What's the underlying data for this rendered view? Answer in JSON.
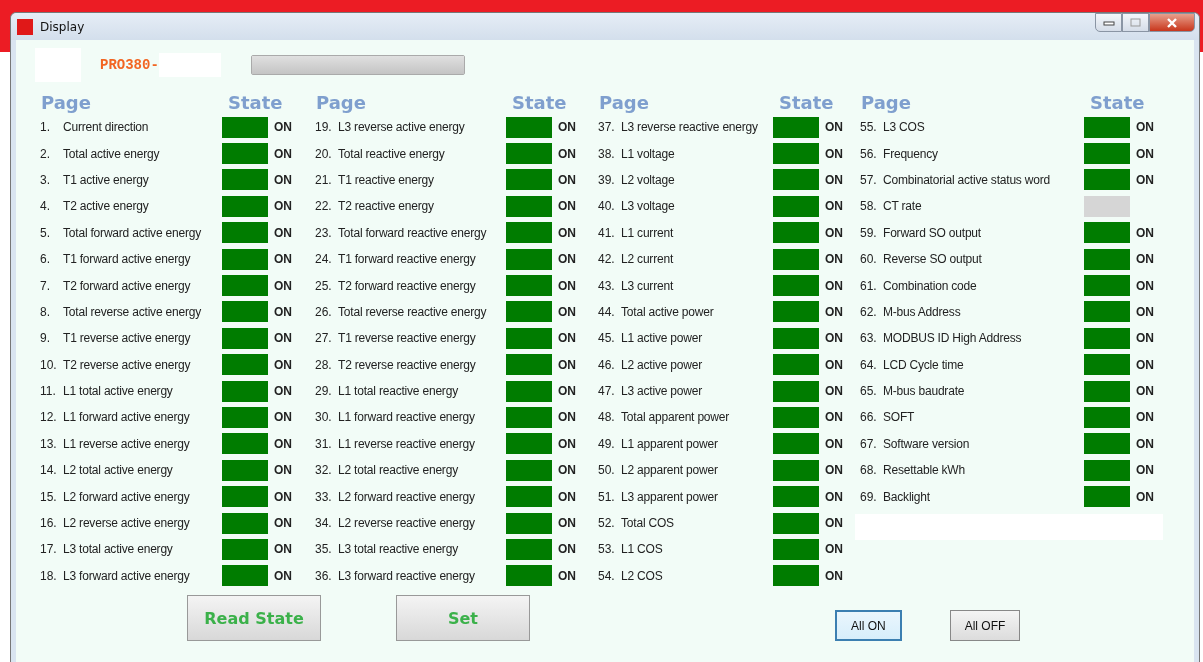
{
  "window": {
    "title": "Display"
  },
  "model": {
    "prefix": "PRO380-"
  },
  "progress": {
    "level": 1
  },
  "columns": [
    {
      "page_header": "Page",
      "state_header": "State",
      "items": [
        {
          "number": "1.",
          "label": "Current direction",
          "on": true,
          "state_text": "ON"
        },
        {
          "number": "2.",
          "label": "Total active energy",
          "on": true,
          "state_text": "ON"
        },
        {
          "number": "3.",
          "label": "T1 active energy",
          "on": true,
          "state_text": "ON"
        },
        {
          "number": "4.",
          "label": "T2 active energy",
          "on": true,
          "state_text": "ON"
        },
        {
          "number": "5.",
          "label": "Total forward active energy",
          "on": true,
          "state_text": "ON"
        },
        {
          "number": "6.",
          "label": "T1 forward active energy",
          "on": true,
          "state_text": "ON"
        },
        {
          "number": "7.",
          "label": "T2 forward active energy",
          "on": true,
          "state_text": "ON"
        },
        {
          "number": "8.",
          "label": "Total reverse active energy",
          "on": true,
          "state_text": "ON"
        },
        {
          "number": "9.",
          "label": "T1 reverse active energy",
          "on": true,
          "state_text": "ON"
        },
        {
          "number": "10.",
          "label": "T2 reverse active energy",
          "on": true,
          "state_text": "ON"
        },
        {
          "number": "11.",
          "label": "L1 total active energy",
          "on": true,
          "state_text": "ON"
        },
        {
          "number": "12.",
          "label": "L1 forward active energy",
          "on": true,
          "state_text": "ON"
        },
        {
          "number": "13.",
          "label": "L1 reverse active energy",
          "on": true,
          "state_text": "ON"
        },
        {
          "number": "14.",
          "label": "L2 total active energy",
          "on": true,
          "state_text": "ON"
        },
        {
          "number": "15.",
          "label": "L2 forward active energy",
          "on": true,
          "state_text": "ON"
        },
        {
          "number": "16.",
          "label": "L2 reverse active energy",
          "on": true,
          "state_text": "ON"
        },
        {
          "number": "17.",
          "label": "L3 total active energy",
          "on": true,
          "state_text": "ON"
        },
        {
          "number": "18.",
          "label": "L3 forward active energy",
          "on": true,
          "state_text": "ON"
        }
      ]
    },
    {
      "page_header": "Page",
      "state_header": "State",
      "items": [
        {
          "number": "19.",
          "label": "L3 reverse active energy",
          "on": true,
          "state_text": "ON"
        },
        {
          "number": "20.",
          "label": "Total reactive energy",
          "on": true,
          "state_text": "ON"
        },
        {
          "number": "21.",
          "label": "T1 reactive energy",
          "on": true,
          "state_text": "ON"
        },
        {
          "number": "22.",
          "label": "T2 reactive energy",
          "on": true,
          "state_text": "ON"
        },
        {
          "number": "23.",
          "label": "Total forward reactive energy",
          "on": true,
          "state_text": "ON"
        },
        {
          "number": "24.",
          "label": "T1 forward reactive energy",
          "on": true,
          "state_text": "ON"
        },
        {
          "number": "25.",
          "label": "T2 forward reactive energy",
          "on": true,
          "state_text": "ON"
        },
        {
          "number": "26.",
          "label": "Total reverse reactive energy",
          "on": true,
          "state_text": "ON"
        },
        {
          "number": "27.",
          "label": "T1 reverse reactive energy",
          "on": true,
          "state_text": "ON"
        },
        {
          "number": "28.",
          "label": "T2 reverse reactive energy",
          "on": true,
          "state_text": "ON"
        },
        {
          "number": "29.",
          "label": "L1 total reactive energy",
          "on": true,
          "state_text": "ON"
        },
        {
          "number": "30.",
          "label": "L1 forward reactive energy",
          "on": true,
          "state_text": "ON"
        },
        {
          "number": "31.",
          "label": "L1 reverse reactive energy",
          "on": true,
          "state_text": "ON"
        },
        {
          "number": "32.",
          "label": "L2 total reactive energy",
          "on": true,
          "state_text": "ON"
        },
        {
          "number": "33.",
          "label": "L2 forward reactive energy",
          "on": true,
          "state_text": "ON"
        },
        {
          "number": "34.",
          "label": "L2 reverse reactive energy",
          "on": true,
          "state_text": "ON"
        },
        {
          "number": "35.",
          "label": "L3 total reactive energy",
          "on": true,
          "state_text": "ON"
        },
        {
          "number": "36.",
          "label": "L3 forward reactive energy",
          "on": true,
          "state_text": "ON"
        }
      ]
    },
    {
      "page_header": "Page",
      "state_header": "State",
      "items": [
        {
          "number": "37.",
          "label": "L3 reverse reactive energy",
          "on": true,
          "state_text": "ON"
        },
        {
          "number": "38.",
          "label": "L1 voltage",
          "on": true,
          "state_text": "ON"
        },
        {
          "number": "39.",
          "label": "L2 voltage",
          "on": true,
          "state_text": "ON"
        },
        {
          "number": "40.",
          "label": "L3 voltage",
          "on": true,
          "state_text": "ON"
        },
        {
          "number": "41.",
          "label": "L1 current",
          "on": true,
          "state_text": "ON"
        },
        {
          "number": "42.",
          "label": "L2 current",
          "on": true,
          "state_text": "ON"
        },
        {
          "number": "43.",
          "label": "L3 current",
          "on": true,
          "state_text": "ON"
        },
        {
          "number": "44.",
          "label": "Total active power",
          "on": true,
          "state_text": "ON"
        },
        {
          "number": "45.",
          "label": "L1 active power",
          "on": true,
          "state_text": "ON"
        },
        {
          "number": "46.",
          "label": "L2 active power",
          "on": true,
          "state_text": "ON"
        },
        {
          "number": "47.",
          "label": "L3 active power",
          "on": true,
          "state_text": "ON"
        },
        {
          "number": "48.",
          "label": "Total apparent power",
          "on": true,
          "state_text": "ON"
        },
        {
          "number": "49.",
          "label": "L1 apparent power",
          "on": true,
          "state_text": "ON"
        },
        {
          "number": "50.",
          "label": "L2 apparent power",
          "on": true,
          "state_text": "ON"
        },
        {
          "number": "51.",
          "label": "L3 apparent power",
          "on": true,
          "state_text": "ON"
        },
        {
          "number": "52.",
          "label": "Total COS",
          "on": true,
          "state_text": "ON"
        },
        {
          "number": "53.",
          "label": "L1 COS",
          "on": true,
          "state_text": "ON"
        },
        {
          "number": "54.",
          "label": "L2 COS",
          "on": true,
          "state_text": "ON"
        }
      ]
    },
    {
      "page_header": "Page",
      "state_header": "State",
      "items": [
        {
          "number": "55.",
          "label": "L3 COS",
          "on": true,
          "state_text": "ON"
        },
        {
          "number": "56.",
          "label": "Frequency",
          "on": true,
          "state_text": "ON"
        },
        {
          "number": "57.",
          "label": "Combinatorial active status word",
          "on": true,
          "state_text": "ON"
        },
        {
          "number": "58.",
          "label": "CT rate",
          "on": false
        },
        {
          "number": "59.",
          "label": "Forward SO output",
          "on": true,
          "state_text": "ON"
        },
        {
          "number": "60.",
          "label": "Reverse SO output",
          "on": true,
          "state_text": "ON"
        },
        {
          "number": "61.",
          "label": "Combination code",
          "on": true,
          "state_text": "ON"
        },
        {
          "number": "62.",
          "label": "M-bus Address",
          "on": true,
          "state_text": "ON"
        },
        {
          "number": "63.",
          "label": "MODBUS ID   High Address",
          "on": true,
          "state_text": "ON"
        },
        {
          "number": "64.",
          "label": "LCD Cycle time",
          "on": true,
          "state_text": "ON"
        },
        {
          "number": "65.",
          "label": "M-bus baudrate",
          "on": true,
          "state_text": "ON"
        },
        {
          "number": "66.",
          "label": "SOFT",
          "on": true,
          "state_text": "ON"
        },
        {
          "number": "67.",
          "label": "Software version",
          "on": true,
          "state_text": "ON"
        },
        {
          "number": "68.",
          "label": "Resettable kWh",
          "on": true,
          "state_text": "ON"
        },
        {
          "number": "69.",
          "label": "Backlight",
          "on": true,
          "state_text": "ON"
        }
      ]
    }
  ],
  "buttons": [
    {
      "label": "Read State",
      "kind": "large",
      "focused": false
    },
    {
      "label": "Set",
      "kind": "large",
      "focused": false
    },
    {
      "label": "All ON",
      "kind": "small",
      "focused": true
    },
    {
      "label": "All OFF",
      "kind": "small",
      "focused": false
    }
  ]
}
